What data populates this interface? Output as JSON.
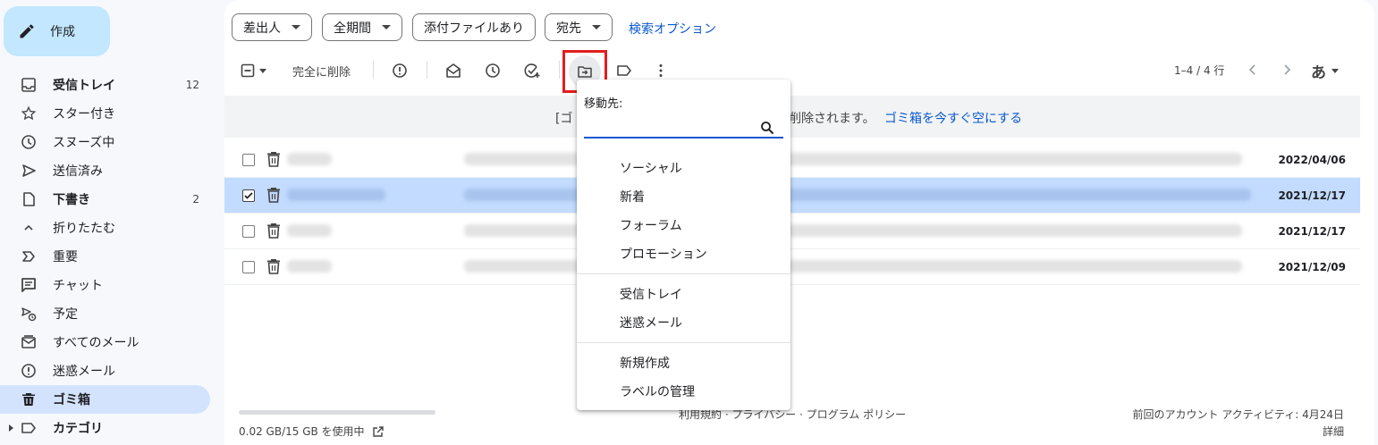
{
  "sidebar": {
    "compose_label": "作成",
    "items": [
      {
        "label": "受信トレイ",
        "count": "12",
        "icon": "inbox-icon"
      },
      {
        "label": "スター付き",
        "count": "",
        "icon": "star-icon"
      },
      {
        "label": "スヌーズ中",
        "count": "",
        "icon": "clock-icon"
      },
      {
        "label": "送信済み",
        "count": "",
        "icon": "send-icon"
      },
      {
        "label": "下書き",
        "count": "2",
        "icon": "draft-icon"
      },
      {
        "label": "折りたたむ",
        "count": "",
        "icon": "chevron-up-icon"
      },
      {
        "label": "重要",
        "count": "",
        "icon": "important-icon"
      },
      {
        "label": "チャット",
        "count": "",
        "icon": "chat-icon"
      },
      {
        "label": "予定",
        "count": "",
        "icon": "scheduled-icon"
      },
      {
        "label": "すべてのメール",
        "count": "",
        "icon": "all-mail-icon"
      },
      {
        "label": "迷惑メール",
        "count": "",
        "icon": "spam-icon"
      },
      {
        "label": "ゴミ箱",
        "count": "",
        "icon": "trash-icon"
      },
      {
        "label": "カテゴリ",
        "count": "",
        "icon": "label-icon"
      }
    ]
  },
  "filters": {
    "sender": "差出人",
    "period": "全期間",
    "has_attachment": "添付ファイルあり",
    "recipient": "宛先",
    "search_options": "検索オプション"
  },
  "toolbar": {
    "delete_forever": "完全に削除"
  },
  "pagination": "1–4 / 4 行",
  "ime_label": "あ",
  "trash_banner": {
    "text_left": "[ゴ",
    "text_right": "削除されます。",
    "empty_link": "ゴミ箱を今すぐ空にする"
  },
  "emails": [
    {
      "date": "2022/04/06",
      "selected": false
    },
    {
      "date": "2021/12/17",
      "selected": true
    },
    {
      "date": "2021/12/17",
      "selected": false
    },
    {
      "date": "2021/12/09",
      "selected": false
    }
  ],
  "move_menu": {
    "heading": "移動先:",
    "search_value": "",
    "categories": [
      "ソーシャル",
      "新着",
      "フォーラム",
      "プロモーション"
    ],
    "folders": [
      "受信トレイ",
      "迷惑メール"
    ],
    "actions": [
      "新規作成",
      "ラベルの管理"
    ]
  },
  "footer": {
    "storage": "0.02 GB/15 GB を使用中",
    "links": "利用規約 · プライバシー · プログラム ポリシー",
    "last_activity": "前回のアカウント アクティビティ: 4月24日",
    "details": "詳細"
  },
  "colors": {
    "accent": "#0b57d0",
    "compose_bg": "#c2e7ff",
    "active_nav_bg": "#d3e3fd",
    "selected_row_bg": "#c2dbff",
    "highlight_box": "#e01e1e"
  }
}
